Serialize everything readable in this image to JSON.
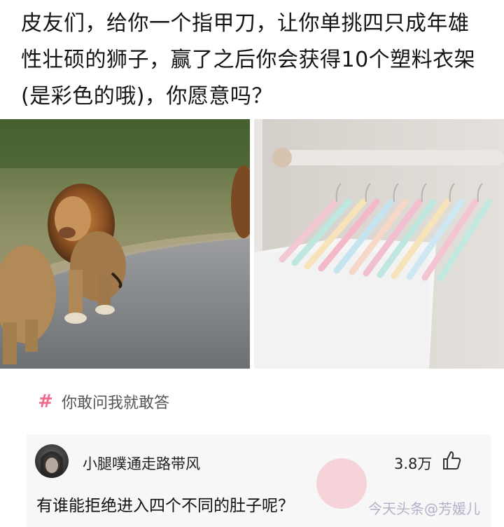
{
  "post": {
    "text": "皮友们，给你一个指甲刀，让你单挑四只成年雄性壮硕的狮子，赢了之后你会获得10个塑料衣架(是彩色的哦)，你愿意吗？"
  },
  "images": {
    "left": "lions-photo",
    "right": "hangers-photo"
  },
  "topic": {
    "icon": "hashtag-icon",
    "label": "你敢问我就敢答",
    "color": "#f06a8e"
  },
  "comment": {
    "username": "小腿噗通走路带风",
    "likes": "3.8万",
    "text": "有谁能拒绝进入四个不同的肚子呢？"
  },
  "watermark": {
    "text": "今天头条@芳媛儿"
  }
}
